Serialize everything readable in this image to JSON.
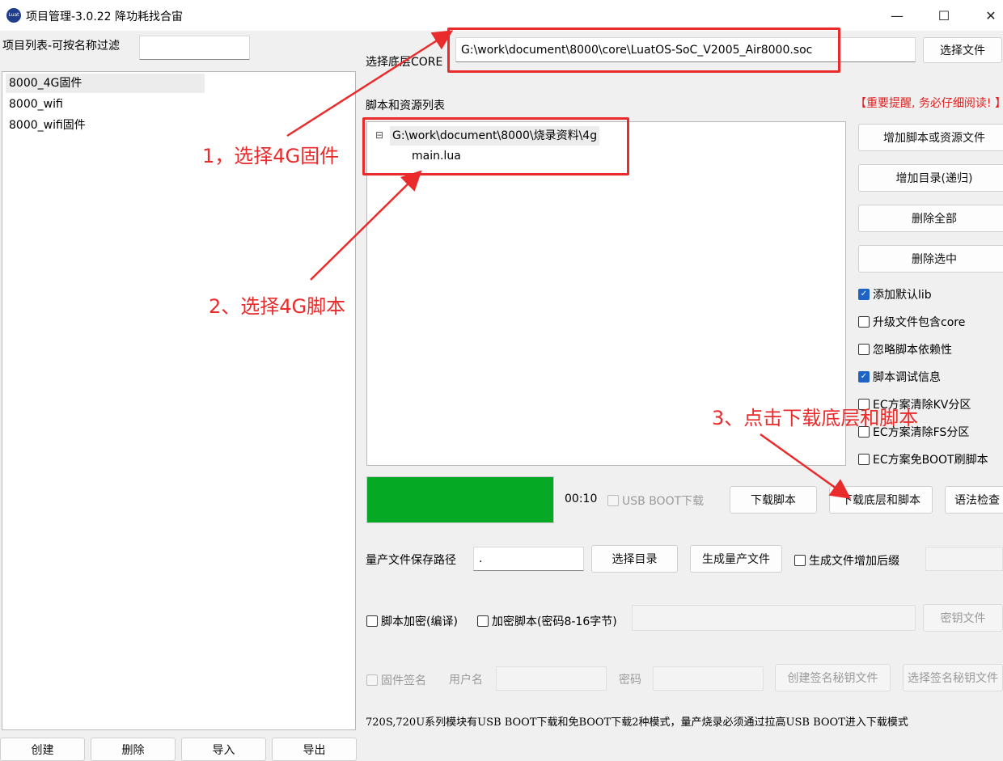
{
  "window": {
    "title": "项目管理-3.0.22 降功耗找合宙",
    "minimize": "—",
    "maximize": "☐",
    "close": "✕"
  },
  "left": {
    "filter_label": "项目列表-可按名称过滤",
    "filter_value": "",
    "projects": [
      "8000_4G固件",
      "8000_wifi",
      "8000_wifi固件"
    ],
    "buttons": {
      "create": "创建",
      "delete": "删除",
      "import": "导入",
      "export": "导出"
    }
  },
  "core": {
    "label": "选择底层CORE",
    "path": "G:\\work\\document\\8000\\core\\LuatOS-SoC_V2005_Air8000.soc",
    "choose_button": "选择文件"
  },
  "scripts": {
    "label": "脚本和资源列表",
    "important_notice": "【重要提醒, 务必仔细阅读! 】",
    "tree_root": "G:\\work\\document\\8000\\烧录资料\\4g",
    "tree_expand": "⊟",
    "tree_children": [
      "main.lua"
    ]
  },
  "right_buttons": {
    "add_file": "增加脚本或资源文件",
    "add_dir": "增加目录(递归)",
    "delete_all": "删除全部",
    "delete_selected": "删除选中"
  },
  "options": [
    {
      "label": "添加默认lib",
      "checked": true
    },
    {
      "label": "升级文件包含core",
      "checked": false
    },
    {
      "label": "忽略脚本依赖性",
      "checked": false
    },
    {
      "label": "脚本调试信息",
      "checked": true
    },
    {
      "label": "EC方案清除KV分区",
      "checked": false
    },
    {
      "label": "EC方案清除FS分区",
      "checked": false
    },
    {
      "label": "EC方案免BOOT刷脚本",
      "checked": false
    }
  ],
  "progress": {
    "color": "#06a924",
    "fraction": 1.0,
    "timer": "00:10"
  },
  "download": {
    "usb_boot": "USB BOOT下载",
    "script_button": "下载脚本",
    "core_and_script_button": "下载底层和脚本",
    "syntax_button": "语法检查"
  },
  "mass": {
    "path_label": "量产文件保存路径",
    "path_value": ".",
    "choose_dir": "选择目录",
    "generate": "生成量产文件",
    "suffix": "生成文件增加后缀"
  },
  "encrypt": {
    "script_encrypt": "脚本加密(编译)",
    "encrypt_with_password": "加密脚本(密码8-16字节)",
    "key_file": "密钥文件"
  },
  "sign": {
    "firmware_sign": "固件签名",
    "username": "用户名",
    "password": "密码",
    "create_key": "创建签名秘钥文件",
    "choose_key": "选择签名秘钥文件"
  },
  "note": "720S,720U系列模块有USB BOOT下载和免BOOT下载2种模式，量产烧录必须通过拉高USB BOOT进入下载模式",
  "annotations": {
    "step1": "1，选择4G固件",
    "step2": "2、选择4G脚本",
    "step3": "3、点击下载底层和脚本"
  },
  "colors": {
    "annotation": "#ea2b2b",
    "check": "#1e63c5"
  }
}
